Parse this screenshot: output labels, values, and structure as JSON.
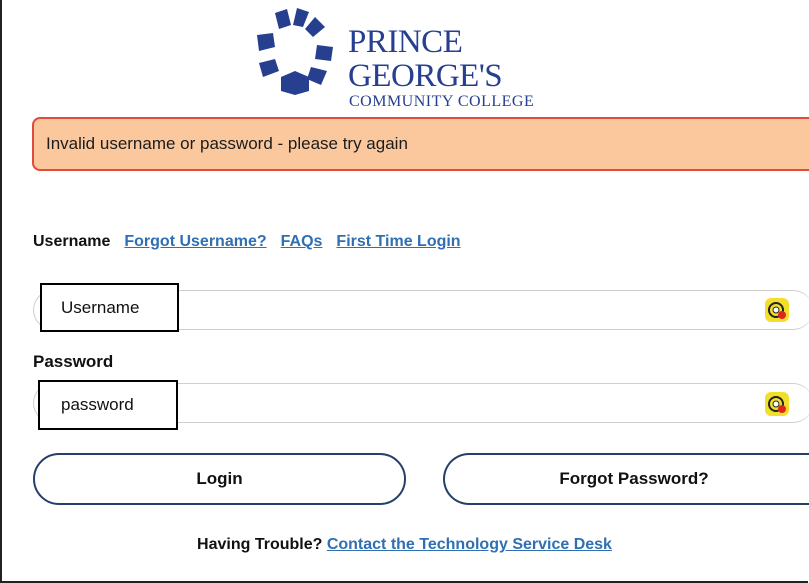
{
  "logo": {
    "line1": "PRINCE GEORGE'S",
    "line2": "COMMUNITY COLLEGE"
  },
  "alert": {
    "message": "Invalid username or password - please try again"
  },
  "username_row": {
    "label": "Username",
    "links": [
      "Forgot Username?",
      "FAQs",
      "First Time Login"
    ]
  },
  "username_field": {
    "value": "Username"
  },
  "password": {
    "label": "Password",
    "value": "password"
  },
  "buttons": {
    "login": "Login",
    "forgot_password": "Forgot Password?"
  },
  "footer": {
    "prefix": "Having Trouble?",
    "link": "Contact the Technology Service Desk"
  },
  "colors": {
    "brand_blue": "#263f8f",
    "link_blue": "#2f6fb2",
    "alert_bg": "#fbc89e",
    "alert_border": "#e24a3b",
    "password_manager_yellow": "#f2df2c"
  }
}
